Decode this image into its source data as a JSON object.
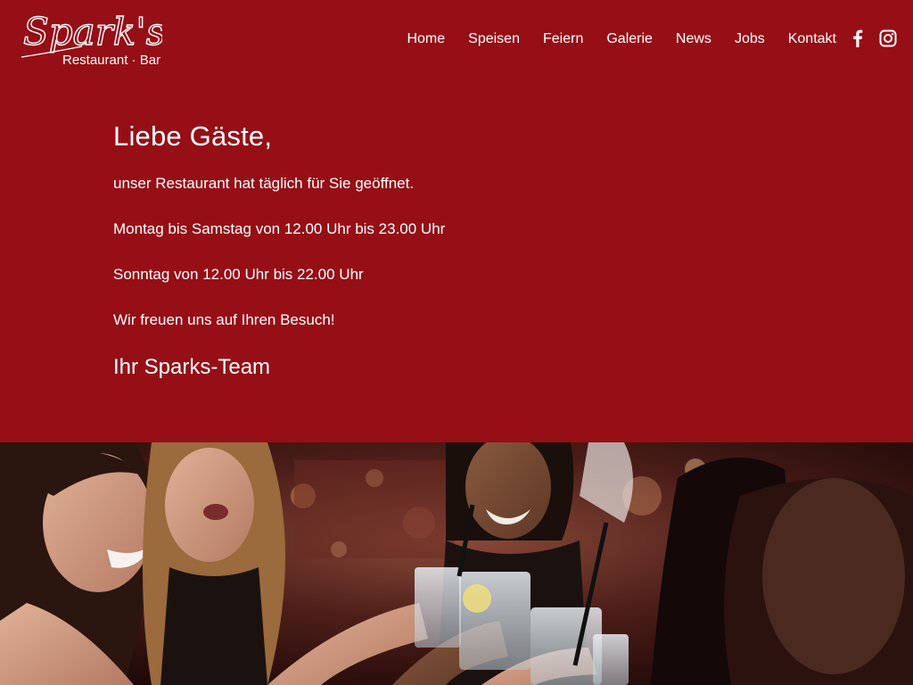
{
  "brand": {
    "logo_main": "Spark's",
    "logo_sub": "Restaurant · Bar"
  },
  "nav": {
    "items": [
      {
        "label": "Home"
      },
      {
        "label": "Speisen"
      },
      {
        "label": "Feiern"
      },
      {
        "label": "Galerie"
      },
      {
        "label": "News"
      },
      {
        "label": "Jobs"
      },
      {
        "label": "Kontakt"
      }
    ]
  },
  "social": {
    "icons": [
      "facebook-icon",
      "instagram-icon"
    ]
  },
  "notice": {
    "heading": "Liebe Gäste,",
    "line1": "unser Restaurant hat täglich für Sie geöffnet.",
    "line2": "Montag bis Samstag von 12.00 Uhr bis 23.00 Uhr",
    "line3": "Sonntag von 12.00 Uhr bis 22.00 Uhr",
    "line4": "Wir freuen uns auf Ihren Besuch!",
    "signature": "Ihr Sparks-Team"
  },
  "colors": {
    "background": "#960f16",
    "text": "#ffffff"
  }
}
